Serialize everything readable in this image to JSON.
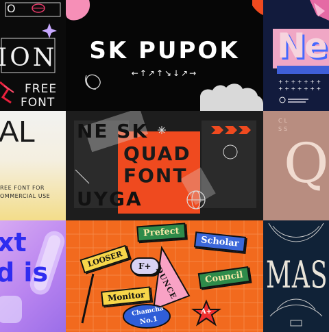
{
  "tiles": {
    "t1": {
      "top_partial": "O",
      "headline": "ION",
      "free_label": "FREE",
      "font_label": "FONT"
    },
    "t2": {
      "title": "SK PUPOK",
      "glyph_row": "←↑↗↑↘↓↗→"
    },
    "t3": {
      "headline": "Ne"
    },
    "t4": {
      "headline": "AL",
      "caption_line1": "REE FONT FOR",
      "caption_line2": "OMMERCIAL USE"
    },
    "t5": {
      "row1": "NE SK",
      "row2": "QUAD",
      "row3": "FONT",
      "row4": "UYGA"
    },
    "t6": {
      "small1": "CL",
      "small2": "SS",
      "letter": "Q"
    },
    "t7": {
      "line1": "xt",
      "line2": "d is"
    },
    "t8": {
      "tags": [
        "Prefect",
        "Scholar",
        "LOOSER",
        "F+",
        "Council",
        "Monitor",
        "Chamcha",
        "No.1",
        "A+",
        "DUNCE"
      ]
    },
    "t9": {
      "headline": "MASH"
    }
  },
  "colors": {
    "orange": "#f26a1e",
    "red_orange": "#ef4a1f",
    "pink": "#f9a2c5",
    "purple": "#a177ef",
    "navy": "#102237"
  }
}
